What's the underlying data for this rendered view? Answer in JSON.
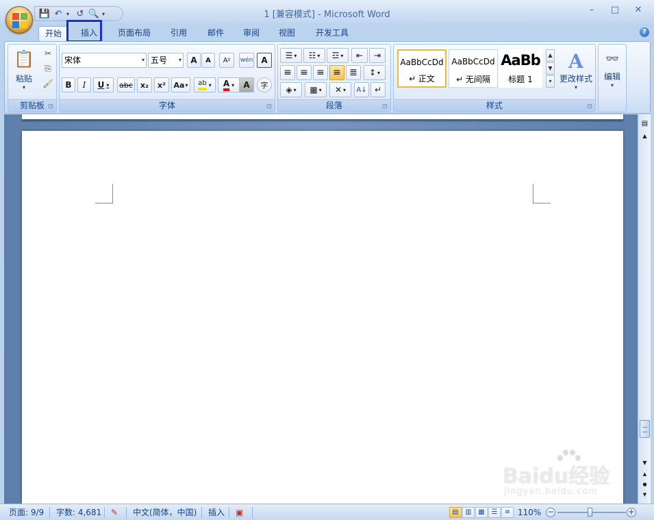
{
  "window": {
    "title": "1 [兼容模式] - Microsoft Word",
    "minimize": "–",
    "maximize": "□",
    "close": "✕"
  },
  "qat": {
    "save": "💾",
    "undo": "↶",
    "redo": "↺",
    "preview": "🔍",
    "more": "▾"
  },
  "tabs": [
    {
      "label": "开始",
      "active": true
    },
    {
      "label": "插入",
      "highlighted": true
    },
    {
      "label": "页面布局"
    },
    {
      "label": "引用"
    },
    {
      "label": "邮件"
    },
    {
      "label": "审阅"
    },
    {
      "label": "视图"
    },
    {
      "label": "开发工具"
    }
  ],
  "help": "?",
  "clipboard": {
    "label": "剪贴板",
    "paste": "粘贴",
    "paste_icon": "📋",
    "cut_icon": "✂",
    "copy_icon": "⎘",
    "format_painter_icon": "🖌"
  },
  "font": {
    "label": "字体",
    "font_name": "宋体",
    "font_size": "五号",
    "grow": "A",
    "shrink": "A",
    "clear": "Aᵡ",
    "phonetic": "wén",
    "border": "A",
    "bold": "B",
    "italic": "I",
    "underline": "U",
    "strike": "abc",
    "subscript": "x₂",
    "superscript": "x²",
    "case": "Aa",
    "highlight": "ab",
    "font_color": "A",
    "shading": "A",
    "enclose": "字"
  },
  "paragraph": {
    "label": "段落",
    "bullets": "☰",
    "numbering": "☷",
    "multilevel": "☲",
    "decrease_indent": "⇤",
    "increase_indent": "⇥",
    "align_left": "≡",
    "center": "≡",
    "align_right": "≡",
    "justify": "≡",
    "distributed": "≣",
    "line_spacing": "↕",
    "shading": "◈",
    "borders": "▦",
    "chinese_layout": "✕",
    "sort": "A↓",
    "show_marks": "↵"
  },
  "styles": {
    "label": "样式",
    "items": [
      {
        "preview": "AaBbCcDd",
        "name": "↵ 正文",
        "selected": true
      },
      {
        "preview": "AaBbCcDd",
        "name": "↵ 无间隔"
      },
      {
        "preview": "AaBb",
        "name": "标题 1"
      }
    ],
    "change_styles": "更改样式",
    "change_icon": "A"
  },
  "editing": {
    "label": "编辑",
    "icon": "👓"
  },
  "scroll": {
    "up": "▲",
    "down": "▼",
    "prev": "▲",
    "select": "●",
    "next": "▼",
    "ruler": "▤"
  },
  "status": {
    "page": "页面: 9/9",
    "words": "字数: 4,681",
    "language": "中文(简体，中国)",
    "mode": "插入",
    "zoom": "110%",
    "zoom_out": "−",
    "zoom_in": "+"
  },
  "watermark": {
    "main": "Baidu经验",
    "sub": "jingyan.baidu.com"
  }
}
